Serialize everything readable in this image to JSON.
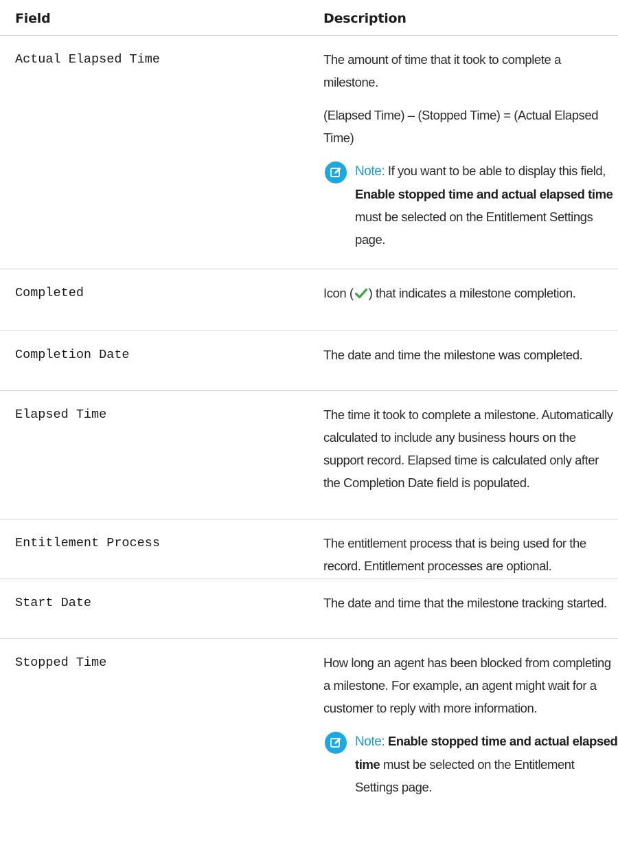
{
  "header": {
    "field_label": "Field",
    "description_label": "Description"
  },
  "rows": [
    {
      "field": "Actual Elapsed Time",
      "paragraphs": [
        "The amount of time that it took to complete a milestone.",
        "(Elapsed Time) – (Stopped Time) = (Actual Elapsed Time)"
      ],
      "note": {
        "label": "Note:",
        "prefix": "If you want to be able to display this field,",
        "bold": "Enable stopped time and actual elapsed time",
        "suffix": "must be selected on the Entitlement Settings page."
      }
    },
    {
      "field": "Completed",
      "desc_before": "Icon (",
      "desc_after": ") that indicates a milestone completion."
    },
    {
      "field": "Completion Date",
      "desc": "The date and time the milestone was completed."
    },
    {
      "field": "Elapsed Time",
      "desc": "The time it took to complete a milestone. Automatically calculated to include any business hours on the support record. Elapsed time is calculated only after the Completion Date field is populated."
    },
    {
      "field": "Entitlement Process",
      "desc": "The entitlement process that is being used for the record. Entitlement processes are optional."
    },
    {
      "field": "Start Date",
      "desc": "The date and time that the milestone tracking started."
    },
    {
      "field": "Stopped Time",
      "desc": "How long an agent has been blocked from completing a milestone. For example, an agent might wait for a customer to reply with more information.",
      "note": {
        "label": "Note:",
        "bold": "Enable stopped time and actual elapsed time",
        "suffix": "must be selected on the Entitlement Settings page."
      }
    }
  ],
  "colors": {
    "note_accent": "#1ea8e0",
    "check_green": "#3aa648",
    "divider": "#d4d4d4"
  },
  "icons": {
    "note": "pencil-note-icon",
    "completed": "checkmark-icon"
  }
}
